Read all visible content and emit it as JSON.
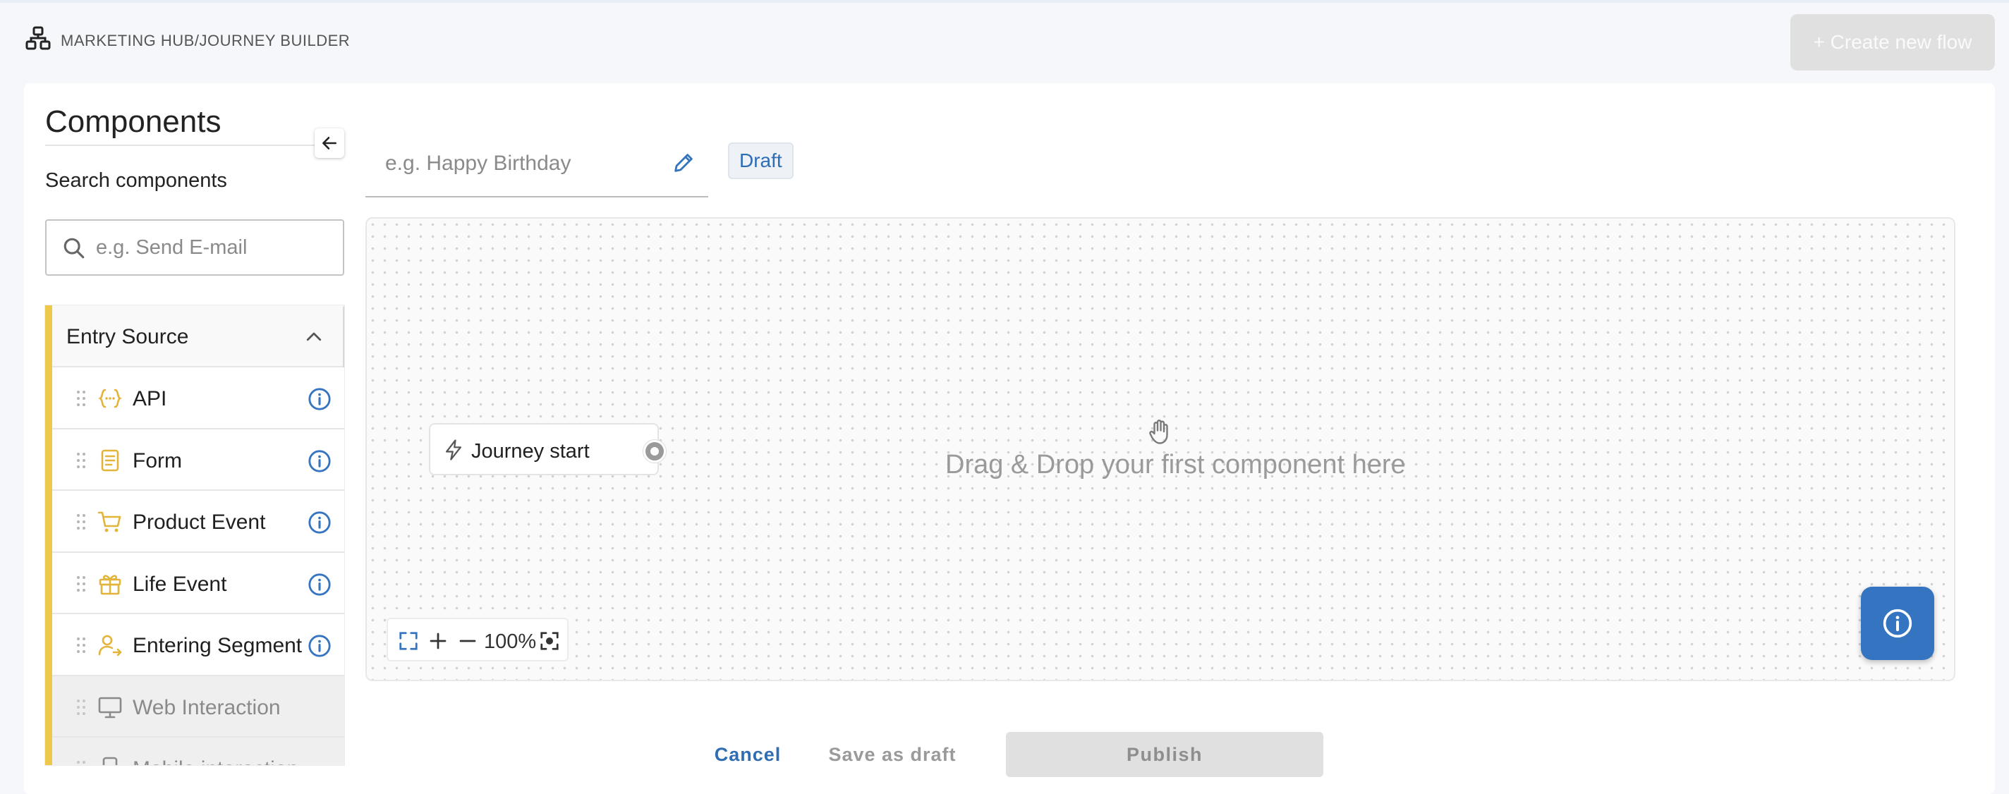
{
  "header": {
    "breadcrumb": "MARKETING HUB/JOURNEY BUILDER",
    "create_button": "+ Create new flow"
  },
  "sidebar": {
    "title": "Components",
    "search_label": "Search components",
    "search_placeholder": "e.g. Send E-mail",
    "section": {
      "label": "Entry Source",
      "accent_color": "#ecc94b",
      "items": [
        {
          "label": "API",
          "icon": "api-brackets-icon",
          "enabled": true
        },
        {
          "label": "Form",
          "icon": "form-document-icon",
          "enabled": true
        },
        {
          "label": "Product Event",
          "icon": "cart-icon",
          "enabled": true
        },
        {
          "label": "Life Event",
          "icon": "gift-icon",
          "enabled": true
        },
        {
          "label": "Entering Segment",
          "icon": "user-segment-icon",
          "enabled": true
        },
        {
          "label": "Web Interaction",
          "icon": "monitor-icon",
          "enabled": false
        },
        {
          "label": "Mobile interaction",
          "icon": "mobile-icon",
          "enabled": false
        }
      ]
    }
  },
  "flow": {
    "name_placeholder": "e.g. Happy Birthday",
    "status_badge": "Draft"
  },
  "canvas": {
    "start_node_label": "Journey start",
    "drop_hint": "Drag & Drop your first component here",
    "zoom_level": "100%"
  },
  "footer": {
    "cancel_label": "Cancel",
    "save_draft_label": "Save as draft",
    "publish_label": "Publish"
  },
  "colors": {
    "primary": "#3474c0",
    "accent": "#ecc94b",
    "disabled": "#e0e0e0"
  }
}
